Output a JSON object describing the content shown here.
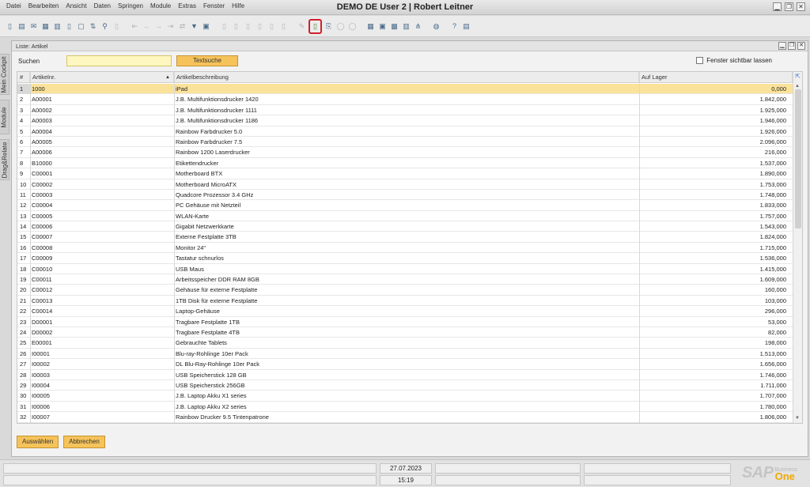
{
  "menu": [
    "Datei",
    "Bearbeiten",
    "Ansicht",
    "Daten",
    "Springen",
    "Module",
    "Extras",
    "Fenster",
    "Hilfe"
  ],
  "app_title": "DEMO DE User 2 | Robert Leitner",
  "window_controls": {
    "minimize": "▁",
    "restore": "❐",
    "close": "✕"
  },
  "toolbar_icons": [
    "new-document-icon",
    "print-icon",
    "email-icon",
    "export-excel-icon",
    "export-word-icon",
    "pdf-icon",
    "preview-icon",
    "refresh-icon",
    "search-icon",
    "add-icon",
    "first-record-icon",
    "previous-record-icon",
    "next-record-icon",
    "last-record-icon",
    "sort-icon",
    "filter-icon",
    "base-document-icon",
    "target-document-icon",
    "gross-profit-icon",
    "payment-icon",
    "volume-weight-icon",
    "journal-entry-icon",
    "copy-icon",
    "highlighted-document-icon",
    "export-icon",
    "settings-icon",
    "messages-icon",
    "alerts-icon",
    "activity-icon",
    "calendar-icon",
    "chart-icon",
    "tree-icon",
    "web-icon",
    "help-icon",
    "database-icon"
  ],
  "side_tabs": {
    "cockpit": "Mein Cockpit",
    "module": "Module",
    "dragrelate": "Drag&Relate"
  },
  "window": {
    "title": "Liste: Artikel",
    "search_label": "Suchen",
    "search_value": "",
    "text_search_button": "Textsuche",
    "checkbox_label": "Fenster sichtbar lassen"
  },
  "table": {
    "col_num": "#",
    "col_id": "Artikelnr.",
    "col_desc": "Artikelbeschreibung",
    "col_stock": "Auf Lager",
    "rows": [
      {
        "n": "1",
        "id": "1000",
        "desc": "iPad",
        "stock": "0,000"
      },
      {
        "n": "2",
        "id": "A00001",
        "desc": "J.B. Multifunktionsdrucker 1420",
        "stock": "1.842,000"
      },
      {
        "n": "3",
        "id": "A00002",
        "desc": "J.B. Multifunktionsdrucker 1111",
        "stock": "1.925,000"
      },
      {
        "n": "4",
        "id": "A00003",
        "desc": "J.B. Multifunktionsdrucker 1186",
        "stock": "1.946,000"
      },
      {
        "n": "5",
        "id": "A00004",
        "desc": "Rainbow Farbdrucker 5.0",
        "stock": "1.926,000"
      },
      {
        "n": "6",
        "id": "A00005",
        "desc": "Rainbow Farbdrucker 7.5",
        "stock": "2.096,000"
      },
      {
        "n": "7",
        "id": "A00006",
        "desc": "Rainbow 1200 Laserdrucker",
        "stock": "216,000"
      },
      {
        "n": "8",
        "id": "B10000",
        "desc": "Etikettendrucker",
        "stock": "1.537,000"
      },
      {
        "n": "9",
        "id": "C00001",
        "desc": "Motherboard BTX",
        "stock": "1.890,000"
      },
      {
        "n": "10",
        "id": "C00002",
        "desc": "Motherboard MicroATX",
        "stock": "1.753,000"
      },
      {
        "n": "11",
        "id": "C00003",
        "desc": "Quadcore Prozessor 3.4 GHz",
        "stock": "1.748,000"
      },
      {
        "n": "12",
        "id": "C00004",
        "desc": "PC Gehäuse mit Netzteil",
        "stock": "1.833,000"
      },
      {
        "n": "13",
        "id": "C00005",
        "desc": "WLAN-Karte",
        "stock": "1.757,000"
      },
      {
        "n": "14",
        "id": "C00006",
        "desc": "Gigabit Netzwerkkarte",
        "stock": "1.543,000"
      },
      {
        "n": "15",
        "id": "C00007",
        "desc": "Externe Festplatte 3TB",
        "stock": "1.824,000"
      },
      {
        "n": "16",
        "id": "C00008",
        "desc": "Monitor 24\"",
        "stock": "1.715,000"
      },
      {
        "n": "17",
        "id": "C00009",
        "desc": "Tastatur schnurlos",
        "stock": "1.536,000"
      },
      {
        "n": "18",
        "id": "C00010",
        "desc": "USB Maus",
        "stock": "1.415,000"
      },
      {
        "n": "19",
        "id": "C00011",
        "desc": "Arbeitsspeicher DDR RAM 8GB",
        "stock": "1.609,000"
      },
      {
        "n": "20",
        "id": "C00012",
        "desc": "Gehäuse für externe Festplatte",
        "stock": "160,000"
      },
      {
        "n": "21",
        "id": "C00013",
        "desc": "1TB Disk für externe Festplatte",
        "stock": "103,000"
      },
      {
        "n": "22",
        "id": "C00014",
        "desc": "Laptop-Gehäuse",
        "stock": "296,000"
      },
      {
        "n": "23",
        "id": "D00001",
        "desc": "Tragbare Festplatte 1TB",
        "stock": "53,000"
      },
      {
        "n": "24",
        "id": "D00002",
        "desc": "Tragbare Festplatte 4TB",
        "stock": "82,000"
      },
      {
        "n": "25",
        "id": "E00001",
        "desc": "Gebrauchte Tablets",
        "stock": "198,000"
      },
      {
        "n": "26",
        "id": "I00001",
        "desc": "Blu-ray-Rohlinge 10er Pack",
        "stock": "1.513,000"
      },
      {
        "n": "27",
        "id": "I00002",
        "desc": "DL Blu-Ray-Rohlinge 10er Pack",
        "stock": "1.656,000"
      },
      {
        "n": "28",
        "id": "I00003",
        "desc": "USB Speicherstick 128 GB",
        "stock": "1.746,000"
      },
      {
        "n": "29",
        "id": "I00004",
        "desc": "USB Speicherstick 256GB",
        "stock": "1.711,000"
      },
      {
        "n": "30",
        "id": "I00005",
        "desc": "J.B. Laptop Akku X1 series",
        "stock": "1.707,000"
      },
      {
        "n": "31",
        "id": "I00006",
        "desc": "J.B. Laptop Akku X2 series",
        "stock": "1.780,000"
      },
      {
        "n": "32",
        "id": "I00007",
        "desc": "Rainbow Drucker 9.5 Tintenpatrone",
        "stock": "1.806,000"
      }
    ]
  },
  "buttons": {
    "select": "Auswählen",
    "cancel": "Abbrechen"
  },
  "status": {
    "date": "27.07.2023",
    "time": "15:19"
  },
  "brand": {
    "sap": "SAP",
    "business": "Business",
    "one": "One"
  },
  "colors": {
    "accent": "#f6c35a",
    "selected_row": "#fbe29b",
    "search_field": "#fff7c0",
    "highlight_border": "#d0212a"
  }
}
